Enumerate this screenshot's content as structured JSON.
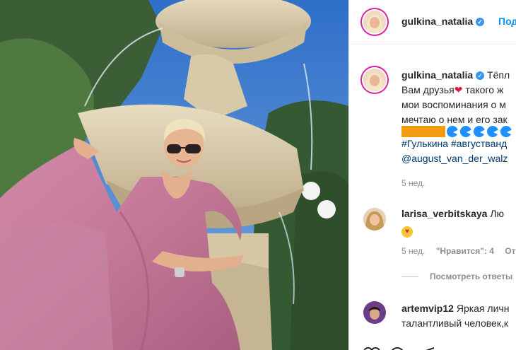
{
  "post": {
    "username": "gulkina_natalia",
    "follow_label": "Под"
  },
  "caption": {
    "username": "gulkina_natalia",
    "line1": "Тёпл",
    "line2a": "Вам друзья",
    "line2b": " такого ж",
    "line3": "мои воспоминания о м",
    "line4": "мечтаю о нем и его зак",
    "hashtags": "#Гулькина #августванд",
    "mention": "@august_van_der_walz",
    "time": "5 нед."
  },
  "comments": [
    {
      "username": "larisa_verbitskaya",
      "text": "Лю",
      "time": "5 нед.",
      "likes": "\"Нравится\": 4",
      "reply": "От",
      "view_replies": "Посмотреть ответы"
    },
    {
      "username": "artemvip12",
      "text": "Яркая личн",
      "text2": "талантливый человек,к"
    }
  ],
  "colors": {
    "accent": "#0095f6",
    "link": "#00376b",
    "verified": "#3897f0",
    "meta": "#8e8e8e"
  },
  "icons": [
    "verified-badge-icon",
    "heart-icon",
    "comment-icon",
    "pacman-emoji-icon",
    "heart-eyes-emoji-icon"
  ]
}
